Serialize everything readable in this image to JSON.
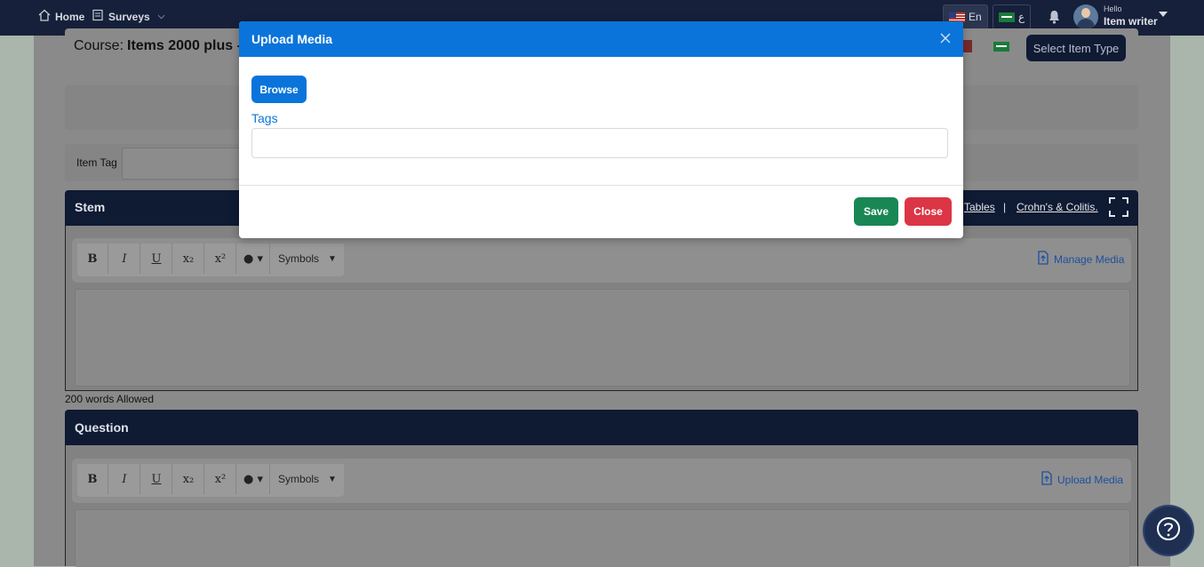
{
  "nav": {
    "home": "Home",
    "surveys": "Surveys",
    "lang_en": "En",
    "lang_ar": "ع",
    "greeting": "Hello",
    "user": "Item writer"
  },
  "course": {
    "label": "Course:",
    "name": "Items 2000 plus -"
  },
  "select_item_type": "Select Item Type",
  "item_tag_label": "Item Tag",
  "stem": {
    "title": "Stem",
    "link_tables": "Tables",
    "separator": "|",
    "link_crohns": "Crohn's & Colitis.",
    "manage_media": "Manage Media",
    "words_allowed": "200 words Allowed"
  },
  "toolbar": {
    "bold": "B",
    "italic": "I",
    "underline": "U",
    "sub": "x₂",
    "sup": "x²",
    "color": "● ▾",
    "symbols": "Symbols"
  },
  "question": {
    "title": "Question",
    "upload_media": "Upload Media"
  },
  "modal": {
    "title": "Upload Media",
    "browse": "Browse",
    "tags_label": "Tags",
    "tags_value": "",
    "save": "Save",
    "close": "Close"
  },
  "colors": {
    "primary": "#0a74da",
    "save": "#198754",
    "close": "#dc3545",
    "nav": "#16203a"
  }
}
